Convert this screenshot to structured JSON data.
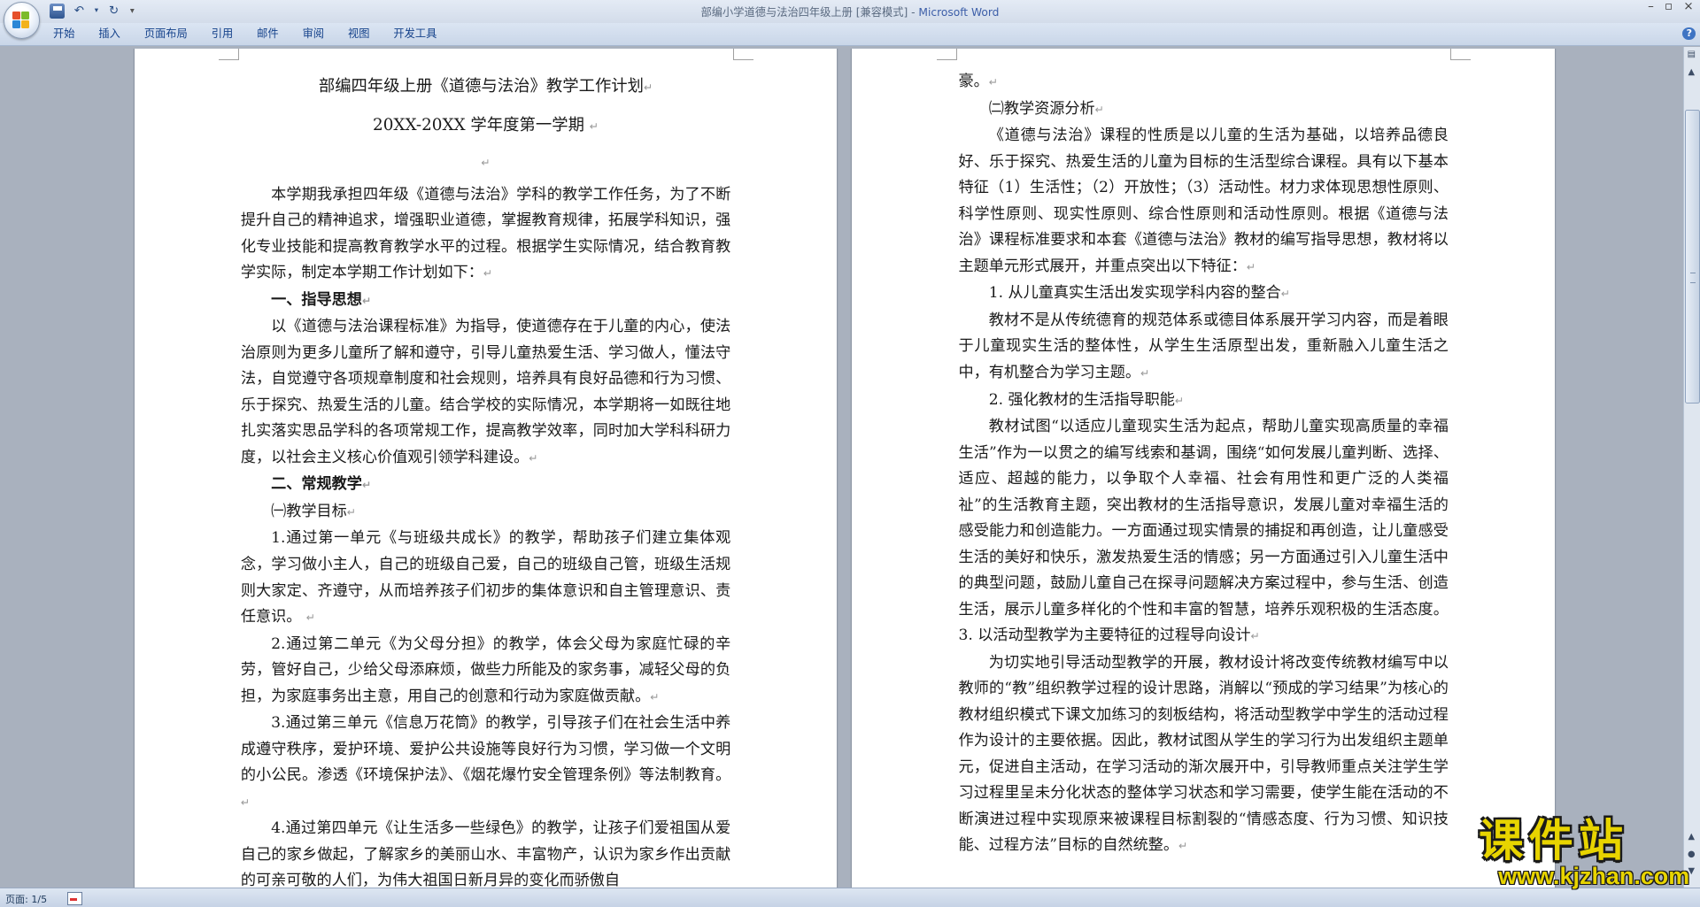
{
  "window": {
    "title_doc": "部编小学道德与法治四年级上册 [兼容模式]",
    "title_sep": " - ",
    "title_app": "Microsoft Word"
  },
  "ribbon": {
    "tabs": [
      "开始",
      "插入",
      "页面布局",
      "引用",
      "邮件",
      "审阅",
      "视图",
      "开发工具"
    ]
  },
  "left_page": {
    "title": "部编四年级上册《道德与法治》教学工作计划",
    "subtitle": "20XX-20XX 学年度第一学期",
    "intro": "本学期我承担四年级《道德与法治》学科的教学工作任务，为了不断提升自己的精神追求，增强职业道德，掌握教育规律，拓展学科知识，强化专业技能和提高教育教学水平的过程。根据学生实际情况，结合教育教学实际，制定本学期工作计划如下：",
    "h1": "一、指导思想",
    "p1": "以《道德与法治课程标准》为指导，使道德存在于儿童的内心，使法治原则为更多儿童所了解和遵守，引导儿童热爱生活、学习做人，懂法守法，自觉遵守各项规章制度和社会规则，培养具有良好品德和行为习惯、乐于探究、热爱生活的儿童。结合学校的实际情况，本学期将一如既往地扎实落实思品学科的各项常规工作，提高教学效率，同时加大学科科研力度，以社会主义核心价值观引领学科建设。",
    "h2": "二、常规教学",
    "sub1": "㈠教学目标",
    "item1": "1.通过第一单元《与班级共成长》的教学，帮助孩子们建立集体观念，学习做小主人，自己的班级自己爱，自己的班级自己管，班级生活规则大家定、齐遵守，从而培养孩子们初步的集体意识和自主管理意识、责任意识。",
    "item2": "2.通过第二单元《为父母分担》的教学，体会父母为家庭忙碌的辛劳，管好自己，少给父母添麻烦，做些力所能及的家务事，减轻父母的负担，为家庭事务出主意，用自己的创意和行动为家庭做贡献。",
    "item3": "3.通过第三单元《信息万花筒》的教学，引导孩子们在社会生活中养成遵守秩序，爱护环境、爱护公共设施等良好行为习惯，学习做一个文明的小公民。渗透《环境保护法》、《烟花爆竹安全管理条例》等法制教育。",
    "item4": "4.通过第四单元《让生活多一些绿色》的教学，让孩子们爱祖国从爱自己的家乡做起，了解家乡的美丽山水、丰富物产，认识为家乡作出贡献的可亲可敬的人们，为伟大祖国日新月异的变化而骄傲自"
  },
  "right_page": {
    "cont": "豪。",
    "sub2": "㈡教学资源分析",
    "p1": "《道德与法治》课程的性质是以儿童的生活为基础，以培养品德良好、乐于探究、热爱生活的儿童为目标的生活型综合课程。具有以下基本特征（1）生活性；（2）开放性；（3）活动性。材力求体现思想性原则、科学性原则、现实性原则、综合性原则和活动性原则。根据《道德与法治》课程标准要求和本套《道德与法治》教材的编写指导思想，教材将以主题单元形式展开，并重点突出以下特征：",
    "n1": "1. 从儿童真实生活出发实现学科内容的整合",
    "p2": "教材不是从传统德育的规范体系或德目体系展开学习内容，而是着眼于儿童现实生活的整体性，从学生生活原型出发，重新融入儿童生活之中，有机整合为学习主题。",
    "n2": "2. 强化教材的生活指导职能",
    "p3": "教材试图“以适应儿童现实生活为起点，帮助儿童实现高质量的幸福生活”作为一以贯之的编写线索和基调，围绕“如何发展儿童判断、选择、适应、超越的能力，以争取个人幸福、社会有用性和更广泛的人类福祉”的生活教育主题，突出教材的生活指导意识，发展儿童对幸福生活的感受能力和创造能力。一方面通过现实情景的捕捉和再创造，让儿童感受生活的美好和快乐，激发热爱生活的情感；另一方面通过引入儿童生活中的典型问题，鼓励儿童自己在探寻问题解决方案过程中，参与生活、创造生活，展示儿童多样化的个性和丰富的智慧，培养乐观积极的生活态度。3. 以活动型教学为主要特征的过程导向设计",
    "p4": "为切实地引导活动型教学的开展，教材设计将改变传统教材编写中以教师的“教”组织教学过程的设计思路，消解以“预成的学习结果”为核心的教材组织模式下课文加练习的刻板结构，将活动型教学中学生的活动过程作为设计的主要依据。因此，教材试图从学生的学习行为出发组织主题单元，促进自主活动，在学习活动的渐次展开中，引导教师重点关注学生学习过程里呈未分化状态的整体学习状态和学习需要，使学生能在活动的不断演进过程中实现原来被课程目标割裂的“情感态度、行为习惯、知识技能、过程方法”目标的自然统整。"
  },
  "status": {
    "page": "页面: 1/5"
  },
  "watermark": {
    "cn": "课件站",
    "url": "www.kjzhan.com"
  },
  "icons": [
    "office-button-icon",
    "save-icon",
    "undo-icon",
    "redo-icon",
    "customize-icon",
    "minimize-icon",
    "maximize-icon",
    "close-icon",
    "help-icon",
    "scroll-up-icon",
    "scroll-down-icon",
    "spelling-status-icon"
  ],
  "colors": {
    "ribbon_text": "#15428b",
    "app_title": "#3c5ea8",
    "watermark": "#e8d400"
  }
}
